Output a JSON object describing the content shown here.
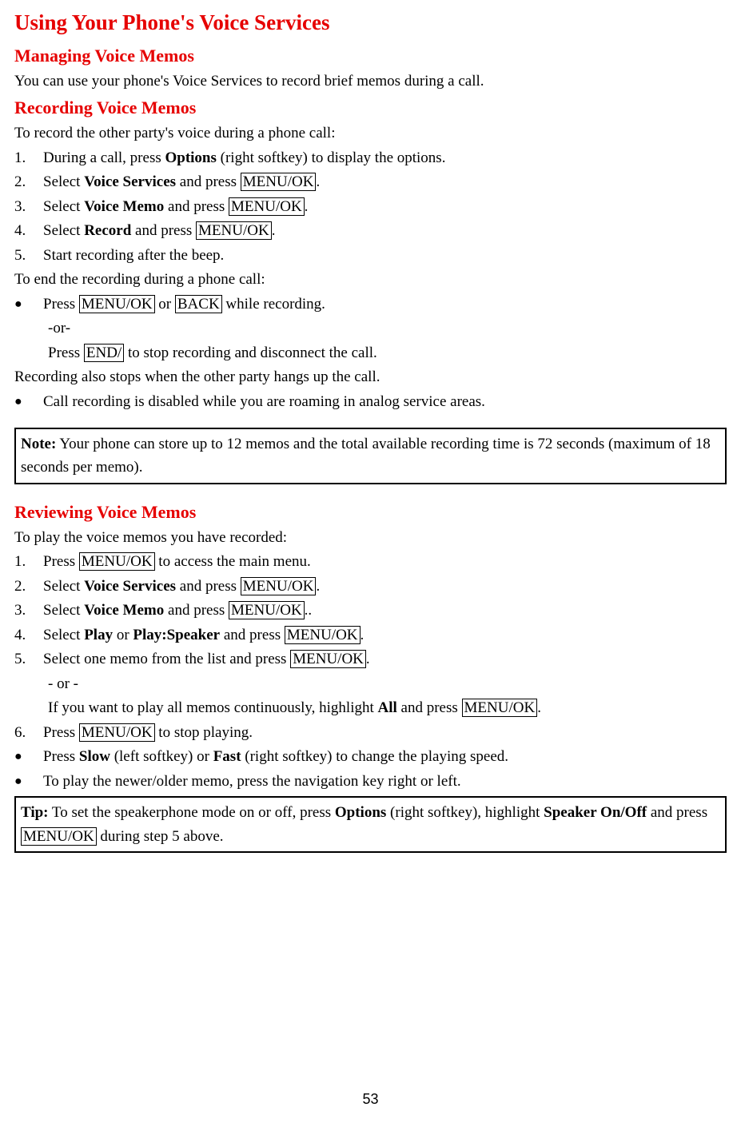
{
  "title": "Using Your Phone's Voice Services",
  "sec1": {
    "heading": "Managing Voice Memos",
    "intro": "You can use your phone's Voice Services to record brief memos during a call."
  },
  "sec2": {
    "heading": "Recording Voice Memos",
    "intro": "To record the other party's voice during a phone call:",
    "steps": {
      "n1": "1.",
      "s1a": "During a call, press ",
      "s1b": "Options",
      "s1c": " (right softkey) to display the options.",
      "n2": "2.",
      "s2a": "Select ",
      "s2b": "Voice Services",
      "s2c": " and press ",
      "s2d": "MENU/OK",
      "s2e": ".",
      "n3": "3.",
      "s3a": "Select ",
      "s3b": "Voice Memo",
      "s3c": " and press ",
      "s3d": "MENU/OK",
      "s3e": ".",
      "n4": "4.",
      "s4a": "Select ",
      "s4b": "Record",
      "s4c": " and press ",
      "s4d": "MENU/OK",
      "s4e": ".",
      "n5": "5.",
      "s5": "Start recording after the beep."
    },
    "end_intro": "To end the recording during a phone call:",
    "b1a": "Press ",
    "b1b": "MENU/OK",
    "b1c": " or ",
    "b1d": "BACK",
    "b1e": " while recording.",
    "b1or": "-or-",
    "b1fa": "Press ",
    "b1fb": "END/",
    "b1fc": " to stop recording and disconnect the call.",
    "after": "Recording also stops when the other party hangs up the call.",
    "b2": " Call recording is disabled while you are roaming in analog service areas.",
    "note_label": "Note:",
    "note_body": " Your phone can store up to 12 memos and the total available recording time is 72 seconds (maximum of 18 seconds per memo)."
  },
  "sec3": {
    "heading": "Reviewing Voice Memos",
    "intro": "To play the voice memos you have recorded:",
    "n1": "1.",
    "s1a": "Press ",
    "s1b": "MENU/OK",
    "s1c": " to access the main menu.",
    "n2": "2.",
    "s2a": "Select ",
    "s2b": "Voice Services",
    "s2c": " and press ",
    "s2d": "MENU/OK",
    "s2e": ".",
    "n3": "3.",
    "s3a": "Select ",
    "s3b": "Voice Memo",
    "s3c": " and press ",
    "s3d": "MENU/OK",
    "s3e": "..",
    "n4": "4.",
    "s4a": "Select ",
    "s4b": "Play",
    "s4c": " or ",
    "s4d": "Play:Speaker",
    "s4e": " and press ",
    "s4f": "MENU/OK",
    "s4g": ".",
    "n5": "5.",
    "s5a": "Select one memo from the list and press ",
    "s5b": "MENU/OK",
    "s5c": ".",
    "s5or": "- or -",
    "s5da": "If you want to play all memos continuously, highlight ",
    "s5db": "All",
    "s5dc": " and press ",
    "s5dd": "MENU/OK",
    "s5de": ".",
    "n6": "6.",
    "s6a": "Press ",
    "s6b": "MENU/OK",
    "s6c": " to stop playing.",
    "b1a": "Press ",
    "b1b": "Slow",
    "b1c": " (left softkey) or ",
    "b1d": "Fast",
    "b1e": " (right softkey) to change the playing speed.",
    "b2": "To play the newer/older memo, press the navigation key right or left.",
    "tip_label": "Tip:",
    "tip_a": " To set the speakerphone mode on or off, press ",
    "tip_b": "Options",
    "tip_c": " (right softkey), highlight ",
    "tip_d": "Speaker On/Off",
    "tip_e": " and press ",
    "tip_f": "MENU/OK",
    "tip_g": " during step 5 above."
  },
  "bullet": "●",
  "page_number": "53"
}
